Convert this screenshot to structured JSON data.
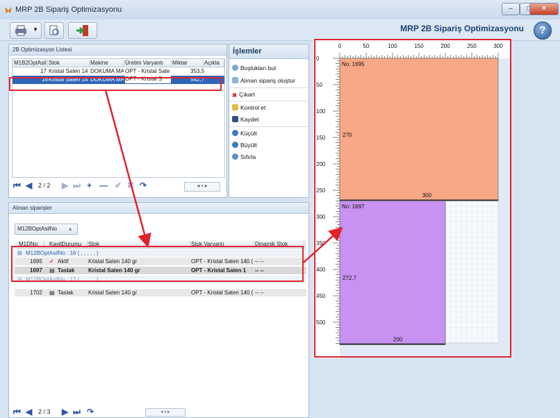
{
  "window": {
    "title": "MRP 2B Sipariş Optimizasyonu"
  },
  "toolbar": {
    "brand": "MRP 2B Sipariş Optimizasyonu",
    "help": "?"
  },
  "list_panel": {
    "title": "2B Optimizasyon Listesi",
    "columns": [
      "M1B2OptAsil",
      "Stok",
      "Makine",
      "Üretim Varyantı",
      "Miktar",
      "Açıkla"
    ],
    "rows": [
      [
        "17",
        "Kristal Saten 14",
        "DOKUMA MA",
        "OPT - Kristal Sate",
        "353,5",
        ""
      ],
      [
        "16",
        "Kristal Saten 14",
        "DOKUMA MA",
        "OPT - Kristal S",
        "542,7",
        ""
      ]
    ],
    "pager": "2 / 2"
  },
  "ops": {
    "title": "İşlemler",
    "items": [
      "Boşlukları bul",
      "Alınan sipariş oluştur",
      "Çıkart",
      "Kontrol et",
      "Kaydet",
      "Küçült",
      "Büyült",
      "Sıfırla"
    ]
  },
  "orders_panel": {
    "title": "Alınan siparişler",
    "group_chip": "M12BOptAsilNo",
    "columns": [
      "M1DNo",
      "KayitDurumu",
      "Stok",
      "Stok Varyantı",
      "Dinamik Stok"
    ],
    "groups": [
      {
        "label": "M12BOptAsilNo : 16 ( , , , , , )",
        "rows": [
          {
            "no": "1695",
            "status": "Aktif",
            "stok": "Kristal Saten 140 gr",
            "variant": "OPT - Kristal Saten 140 (",
            "dyn": "-- --"
          },
          {
            "no": "1697",
            "status": "Taslak",
            "stok": "Kristal Saten 140 gr",
            "variant": "OPT - Kristal Saten 1",
            "dyn": "-- --"
          }
        ]
      },
      {
        "label": "M12BOptAsilNo : 17 ( , , , , , )",
        "rows": [
          {
            "no": "1702",
            "status": "Taslak",
            "stok": "Kristal Saten 140 gr",
            "variant": "OPT - Kristal Saten 140 (",
            "dyn": "-- --"
          }
        ]
      }
    ],
    "pager": "2 / 3"
  },
  "canvas": {
    "top_ticks": [
      "0",
      "50",
      "100",
      "150",
      "200",
      "250",
      "300"
    ],
    "left_ticks": [
      "0",
      "50",
      "100",
      "150",
      "200",
      "250",
      "300",
      "350",
      "400",
      "450",
      "500"
    ],
    "pieces": [
      {
        "label": "No: 1695",
        "width": "300",
        "height": "270",
        "color": "#f8a886",
        "w": 300,
        "h": 270
      },
      {
        "label": "No: 1697",
        "width": "200",
        "height": "272,7",
        "color": "#c792f2",
        "w": 200,
        "h": 272.7
      }
    ]
  },
  "colors": {
    "accent": "#2f66b8",
    "arrow": "#e0232c"
  }
}
